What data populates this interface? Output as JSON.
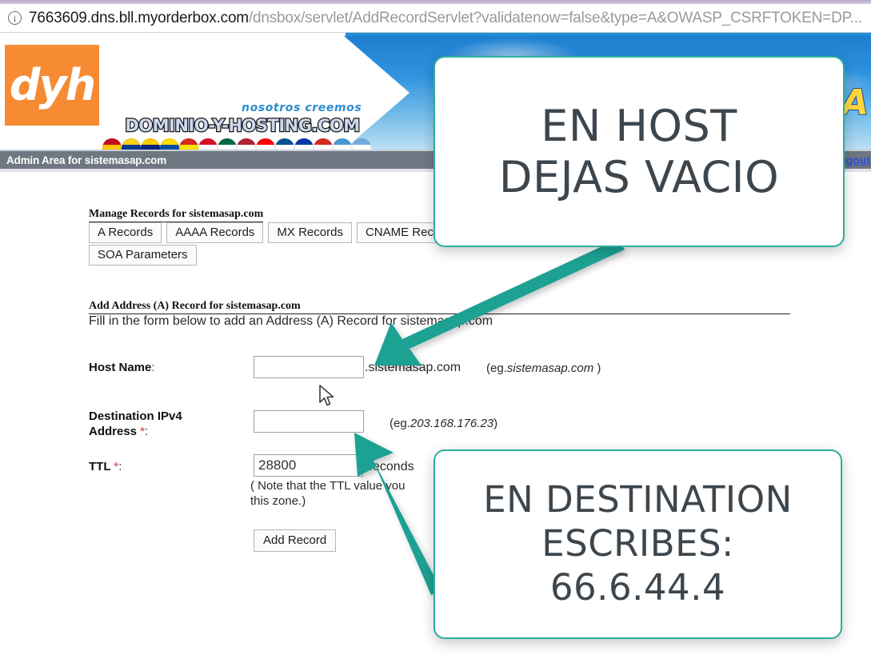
{
  "browser": {
    "info_icon": "info-circle-icon",
    "url_host": "7663609.dns.bll.myorderbox.com",
    "url_path": "/dnsbox/servlet/AddRecordServlet?validatenow=false&type=A&OWASP_CSRFTOKEN=DP..."
  },
  "banner": {
    "logo_text": "dyh",
    "tagline": "nosotros creemos",
    "brand": "DOMINIO-Y-HOSTING.COM",
    "right_text": "CA",
    "flags": [
      {
        "name": "flag-spain",
        "colors": [
          "#c60b1e",
          "#ffc400",
          "#c60b1e"
        ]
      },
      {
        "name": "flag-colombia",
        "colors": [
          "#fcd116",
          "#003893",
          "#ce1126"
        ]
      },
      {
        "name": "flag-venezuela",
        "colors": [
          "#ffcc00",
          "#00247d",
          "#cf142b"
        ]
      },
      {
        "name": "flag-ecuador",
        "colors": [
          "#ffdd00",
          "#034ea2",
          "#ed1c24"
        ]
      },
      {
        "name": "flag-bolivia",
        "colors": [
          "#d52b1e",
          "#f9e300",
          "#007934"
        ]
      },
      {
        "name": "flag-peru",
        "colors": [
          "#d91023",
          "#ffffff",
          "#d91023"
        ]
      },
      {
        "name": "flag-mexico",
        "colors": [
          "#006847",
          "#ffffff",
          "#ce1126"
        ]
      },
      {
        "name": "flag-usa",
        "colors": [
          "#b22234",
          "#ffffff",
          "#3c3b6e"
        ]
      },
      {
        "name": "flag-switzerland",
        "colors": [
          "#ff0000",
          "#ffffff",
          "#ff0000"
        ]
      },
      {
        "name": "flag-panama",
        "colors": [
          "#005293",
          "#ffffff",
          "#d21034"
        ]
      },
      {
        "name": "flag-chile",
        "colors": [
          "#0039a6",
          "#ffffff",
          "#d52b1e"
        ]
      },
      {
        "name": "flag-paraguay",
        "colors": [
          "#d52b1e",
          "#ffffff",
          "#0038a8"
        ]
      },
      {
        "name": "flag-guatemala",
        "colors": [
          "#4997d0",
          "#ffffff",
          "#4997d0"
        ]
      },
      {
        "name": "flag-argentina",
        "colors": [
          "#74acdf",
          "#ffffff",
          "#74acdf"
        ]
      }
    ]
  },
  "adminbar": {
    "title": "Admin Area for sistemasap.com",
    "logout_label": "Logout"
  },
  "manage": {
    "heading": "Manage Records for sistemasap.com",
    "tabs_row1": [
      "A Records",
      "AAAA Records",
      "MX Records",
      "CNAME Records"
    ],
    "tabs_row2": [
      "SOA Parameters"
    ]
  },
  "form": {
    "heading": "Add Address (A) Record for sistemasap.com",
    "subtitle": "Fill in the form below to add an Address (A) Record for sistemasap.com",
    "host": {
      "label": "Host Name",
      "colon": ":",
      "value": "",
      "suffix": ".sistemasap.com",
      "example": "(eg.",
      "example_em": "sistemasap.com",
      "example_end": " )"
    },
    "destination": {
      "label_line1": "Destination IPv4",
      "label_line2": "Address",
      "required_mark": "*",
      "colon": ":",
      "value": "",
      "example": "(eg.",
      "example_em": "203.168.176.23",
      "example_end": ")"
    },
    "ttl": {
      "label": "TTL",
      "required_mark": "*",
      "colon": ":",
      "value": "28800",
      "unit": "seconds",
      "note_line1": "( Note that the TTL value you",
      "note_line2": "this zone.)"
    },
    "submit_label": "Add Record"
  },
  "callouts": {
    "host": {
      "line1": "EN HOST",
      "line2": "DEJAS VACIO"
    },
    "destination": {
      "line1": "EN DESTINATION",
      "line2": "ESCRIBES:",
      "line3": "66.6.44.4"
    }
  },
  "colors": {
    "accent_teal": "#2eae9e",
    "arrow_teal": "#1ba193",
    "logo_orange": "#f68b33",
    "adminbar_gray": "#6f7782",
    "link_blue": "#2b4fd8"
  }
}
